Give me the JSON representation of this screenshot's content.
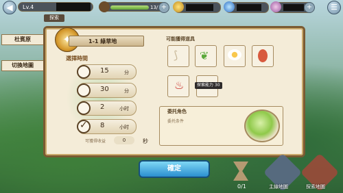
{
  "hud": {
    "level": "Lv.4",
    "sub_tag": "探索",
    "stamina": "13/13",
    "stamina_fraction": 1.0,
    "plus": "+"
  },
  "side": {
    "location": "杜賓原",
    "switch_map": "切換地圖"
  },
  "dialog": {
    "stage": "1-1 綠草地",
    "time_title": "選擇時間",
    "times": [
      {
        "value": "15",
        "unit": "分",
        "checked": false
      },
      {
        "value": "30",
        "unit": "分",
        "checked": false
      },
      {
        "value": "2",
        "unit": "小时",
        "checked": false
      },
      {
        "value": "8",
        "unit": "小时",
        "checked": true
      }
    ],
    "recommend_label": "可獲得收益",
    "recommend_value": "0",
    "sec": "秒",
    "rewards_title": "可能獲得道具",
    "tooltip": "探索能力 30",
    "lord_title": "委托角色",
    "lord_line": "委托条件",
    "confirm": "確定"
  },
  "bottom": {
    "count": "0/1",
    "main_map": "主線地圖",
    "explore_map": "探索地圖"
  }
}
